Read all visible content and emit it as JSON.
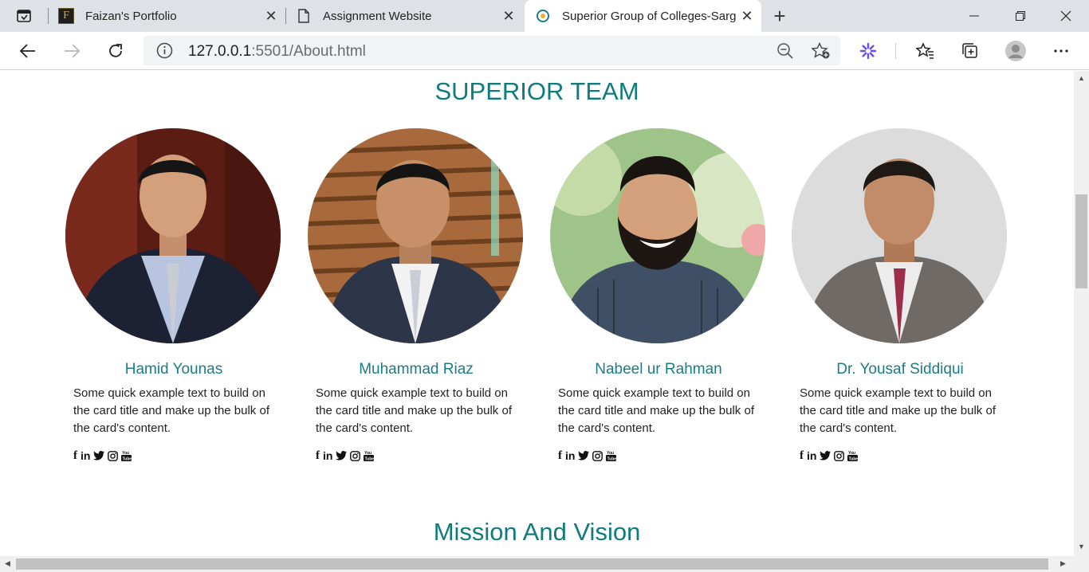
{
  "browser": {
    "tabs": [
      {
        "title": "Faizan's Portfolio",
        "favicon": "F"
      },
      {
        "title": "Assignment Website"
      },
      {
        "title": "Superior Group of Colleges-Sarg"
      }
    ],
    "address": {
      "host": "127.0.0.1",
      "rest": ":5501/About.html"
    }
  },
  "page": {
    "team_title": "SUPERIOR TEAM",
    "mission_title": "Mission And Vision",
    "members": [
      {
        "name": "Hamid Younas",
        "text": "Some quick example text to build on the card title and make up the bulk of the card's content."
      },
      {
        "name": "Muhammad Riaz",
        "text": "Some quick example text to build on the card title and make up the bulk of the card's content."
      },
      {
        "name": "Nabeel ur Rahman",
        "text": "Some quick example text to build on the card title and make up the bulk of the card's content."
      },
      {
        "name": "Dr. Yousaf Siddiqui",
        "text": "Some quick example text to build on the card title and make up the bulk of the card's content."
      }
    ],
    "social_icons": [
      "facebook-icon",
      "linkedin-icon",
      "twitter-icon",
      "instagram-icon",
      "youtube-icon"
    ]
  }
}
